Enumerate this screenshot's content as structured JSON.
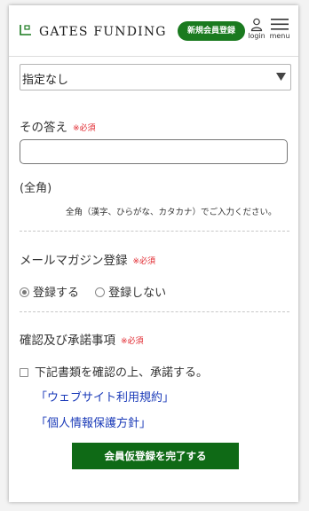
{
  "header": {
    "logo_text": "GATES FUNDING",
    "signup_label": "新規会員登録",
    "login_label": "login",
    "menu_label": "menu"
  },
  "select": {
    "value": "指定なし"
  },
  "answer": {
    "label": "その答え",
    "required": "※必須",
    "value": "",
    "hint": "(全角)",
    "note": "全角（漢字、ひらがな、カタカナ）でご入力ください。"
  },
  "newsletter": {
    "label": "メールマガジン登録",
    "required": "※必須",
    "options": [
      {
        "label": "登録する",
        "selected": true
      },
      {
        "label": "登録しない",
        "selected": false
      }
    ]
  },
  "agreement": {
    "label": "確認及び承諾事項",
    "required": "※必須",
    "checkbox_label": "下記書類を確認の上、承諾する。",
    "checked": false,
    "links": [
      "「ウェブサイト利用規約」",
      "「個人情報保護方針」"
    ]
  },
  "submit": {
    "label": "会員仮登録を完了する"
  },
  "colors": {
    "brand_green": "#1a7a1f",
    "required_red": "#e0242b",
    "link_blue": "#1a3ab8"
  },
  "icons": [
    "logo-mark-icon",
    "user-icon",
    "hamburger-menu-icon",
    "chevron-down-icon"
  ]
}
